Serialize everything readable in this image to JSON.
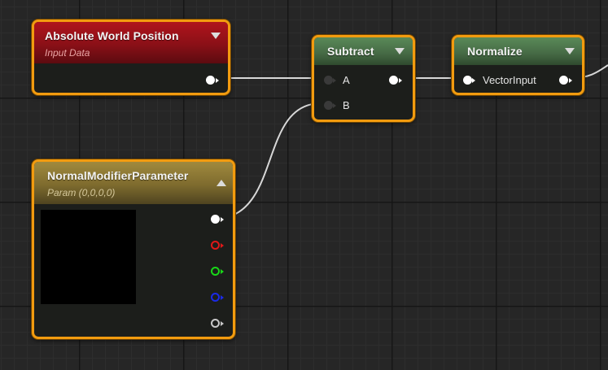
{
  "nodes": {
    "absolute_world_position": {
      "title": "Absolute World Position",
      "subtitle": "Input Data",
      "header_color": "#8e1118"
    },
    "subtract": {
      "title": "Subtract",
      "pins": {
        "a": "A",
        "b": "B"
      },
      "header_color": "#456944"
    },
    "normalize": {
      "title": "Normalize",
      "pins": {
        "input": "VectorInput"
      },
      "header_color": "#456944"
    },
    "normal_modifier_parameter": {
      "title": "NormalModifierParameter",
      "subtitle": "Param (0,0,0,0)",
      "header_color": "#7e6b2e"
    }
  },
  "colors": {
    "node_border": "#f29b0f",
    "wire": "#d8d8d8",
    "pin_red": "#e01818",
    "pin_green": "#18d818",
    "pin_blue": "#1a2ae6",
    "pin_gray": "#c8c8c8"
  }
}
